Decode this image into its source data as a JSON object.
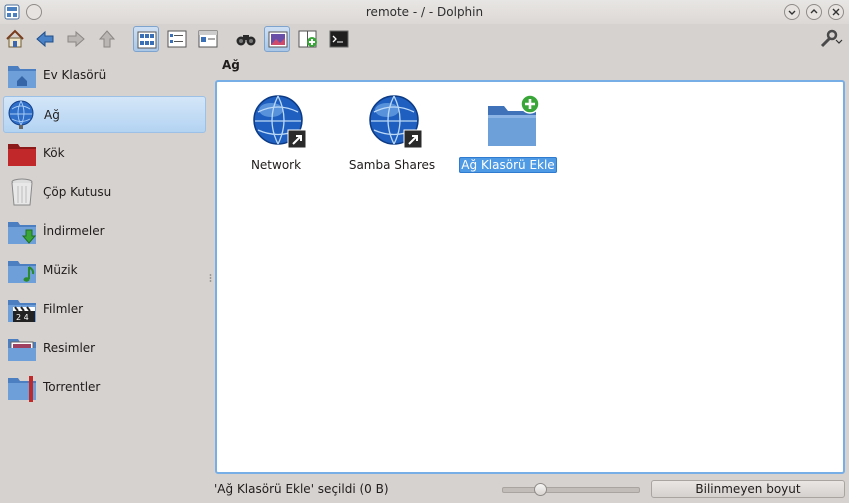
{
  "window": {
    "title": "remote - / - Dolphin"
  },
  "toolbar": {
    "buttons": [
      {
        "name": "home-button",
        "icon": "home-icon"
      },
      {
        "name": "back-button",
        "icon": "arrow-left-icon"
      },
      {
        "name": "forward-button",
        "icon": "arrow-right-icon"
      },
      {
        "name": "up-button",
        "icon": "arrow-up-icon"
      },
      {
        "name": "icons-view-button",
        "icon": "icons-view-icon",
        "checked": true
      },
      {
        "name": "compact-view-button",
        "icon": "compact-view-icon"
      },
      {
        "name": "details-view-button",
        "icon": "details-view-icon"
      },
      {
        "name": "find-button",
        "icon": "binoculars-icon"
      },
      {
        "name": "preview-button",
        "icon": "preview-icon",
        "checked": true
      },
      {
        "name": "split-button",
        "icon": "split-view-icon"
      },
      {
        "name": "terminal-button",
        "icon": "terminal-icon"
      },
      {
        "name": "configure-button",
        "icon": "wrench-icon"
      }
    ]
  },
  "places": [
    {
      "label": "Ev Klasörü",
      "icon": "home-folder-icon"
    },
    {
      "label": "Ağ",
      "icon": "network-icon",
      "active": true
    },
    {
      "label": "Kök",
      "icon": "root-folder-icon"
    },
    {
      "label": "Çöp Kutusu",
      "icon": "trash-icon"
    },
    {
      "label": "İndirmeler",
      "icon": "downloads-folder-icon"
    },
    {
      "label": "Müzik",
      "icon": "music-folder-icon"
    },
    {
      "label": "Filmler",
      "icon": "videos-folder-icon"
    },
    {
      "label": "Resimler",
      "icon": "pictures-folder-icon"
    },
    {
      "label": "Torrentler",
      "icon": "torrents-folder-icon"
    }
  ],
  "location": {
    "label": "Ağ"
  },
  "items": [
    {
      "name": "Network",
      "icon": "globe-link-icon"
    },
    {
      "name": "Samba Shares",
      "icon": "globe-link-icon"
    },
    {
      "name": "Ağ Klasörü Ekle",
      "icon": "folder-add-icon",
      "selected": true
    }
  ],
  "status": {
    "text": "'Ağ Klasörü Ekle' seçildi (0 B)",
    "zoom_fraction": 0.25,
    "space": "Bilinmeyen boyut"
  },
  "colors": {
    "selection": "#4f9ae4",
    "view_border": "#78aee6",
    "folder_blue": "#5b8fce"
  }
}
